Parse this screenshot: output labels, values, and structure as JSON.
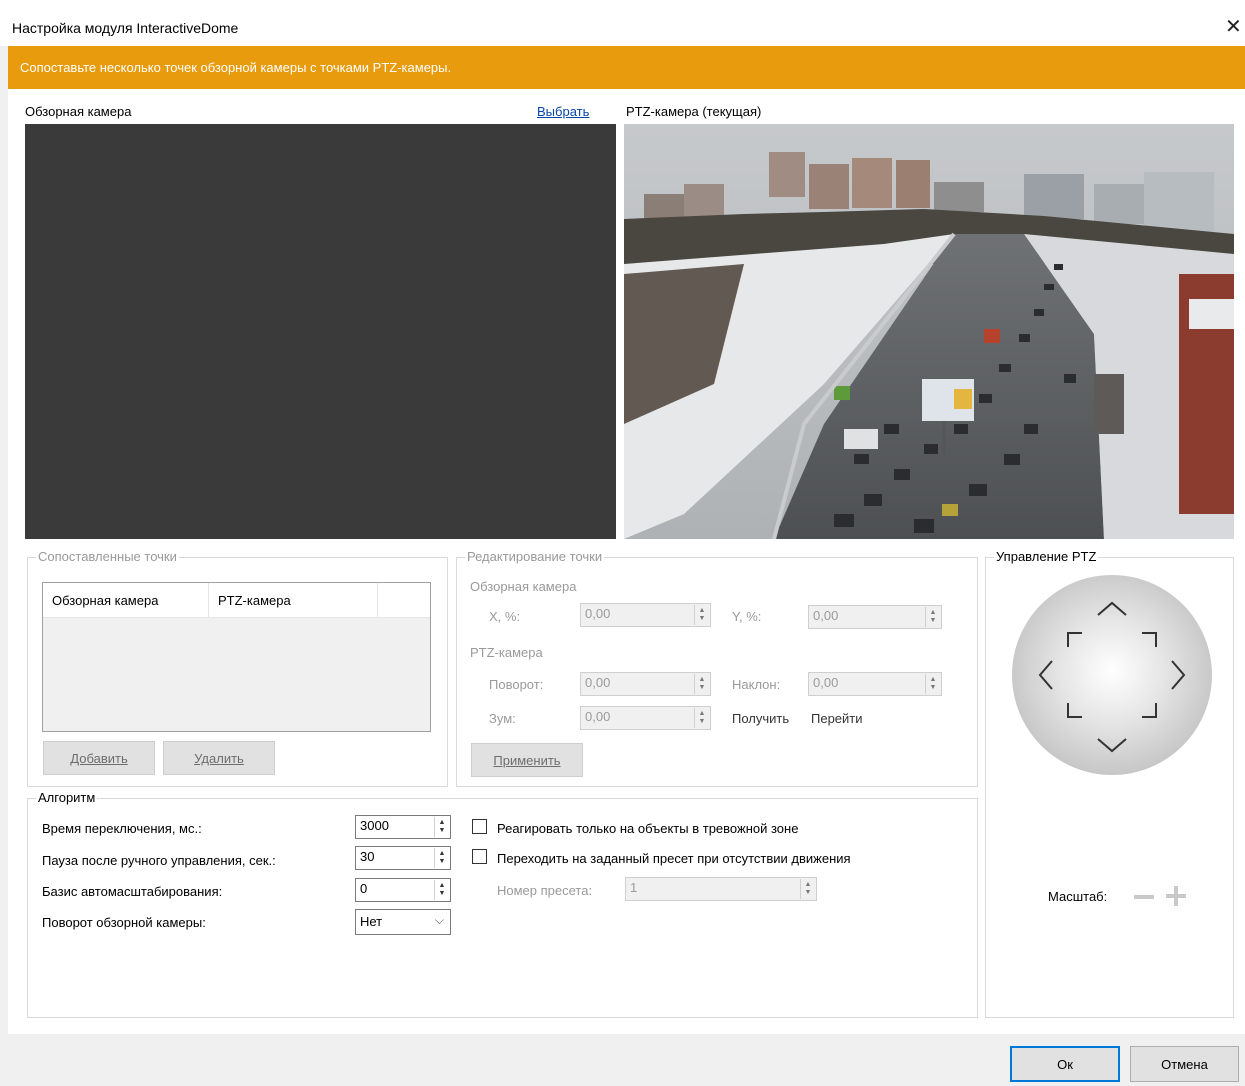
{
  "window": {
    "title": "Настройка модуля InteractiveDome",
    "close_glyph": "✕"
  },
  "banner": {
    "text": "Сопоставьте несколько точек обзорной камеры с точками PTZ-камеры.",
    "color": "#e89b0c"
  },
  "overview_camera": {
    "label": "Обзорная камера",
    "select_link": "Выбрать"
  },
  "ptz_camera": {
    "label": "PTZ-камера (текущая)"
  },
  "matched_points": {
    "title": "Сопоставленные точки",
    "columns": [
      "Обзорная камера",
      "PTZ-камера"
    ],
    "add_button": "Добавить",
    "delete_button": "Удалить"
  },
  "edit_point": {
    "title": "Редактирование точки",
    "overview_label": "Обзорная камера",
    "x_label": "X, %:",
    "x_value": "0,00",
    "y_label": "Y, %:",
    "y_value": "0,00",
    "ptz_label": "PTZ-камера",
    "pan_label": "Поворот:",
    "pan_value": "0,00",
    "tilt_label": "Наклон:",
    "tilt_value": "0,00",
    "zoom_label": "Зум:",
    "zoom_value": "0,00",
    "get_link": "Получить",
    "goto_link": "Перейти",
    "apply_button": "Применить"
  },
  "algorithm": {
    "title": "Алгоритм",
    "switch_time_label": "Время переключения, мс.:",
    "switch_time_value": "3000",
    "pause_label": "Пауза после ручного управления, сек.:",
    "pause_value": "30",
    "autoscale_label": "Базис автомасштабирования:",
    "autoscale_value": "0",
    "rotation_label": "Поворот обзорной камеры:",
    "rotation_value": "Нет",
    "alarm_zone_checkbox": "Реагировать только на объекты в тревожной зоне",
    "alarm_zone_checked": false,
    "preset_checkbox": "Переходить на заданный пресет при отсутствии движения",
    "preset_checked": false,
    "preset_number_label": "Номер пресета:",
    "preset_number_value": "1"
  },
  "ptz_control": {
    "title": "Управление PTZ",
    "zoom_label": "Масштаб:",
    "zoom_out_icon": "minus-icon",
    "zoom_in_icon": "plus-icon"
  },
  "footer": {
    "ok_button": "Ок",
    "cancel_button": "Отмена"
  }
}
